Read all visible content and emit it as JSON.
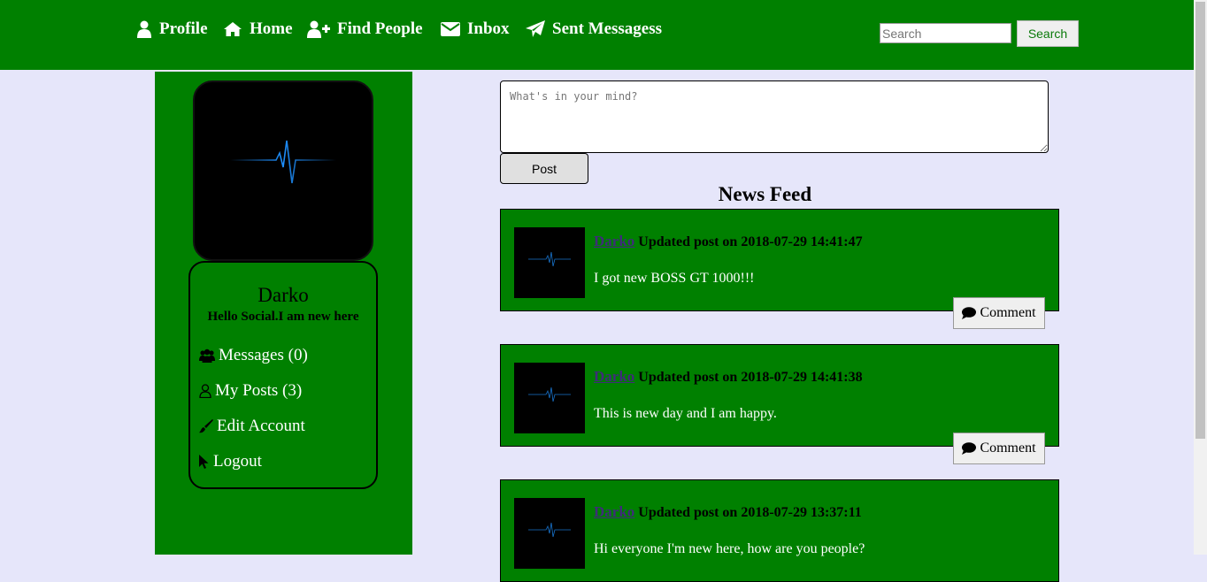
{
  "nav": {
    "profile": "Profile",
    "home": "Home",
    "find_people": "Find People",
    "inbox": "Inbox",
    "sent_messages": "Sent Messagess"
  },
  "search": {
    "placeholder": "Search",
    "button": "Search"
  },
  "sidebar": {
    "name": "Darko",
    "bio": "Hello Social.I am new here",
    "links": {
      "messages": "Messages (0)",
      "my_posts": "My Posts (3)",
      "edit_account": "Edit Account",
      "logout": "Logout"
    }
  },
  "composer": {
    "placeholder": "What's in your mind?",
    "post_button": "Post"
  },
  "feed": {
    "title": "News Feed",
    "comment_label": "Comment",
    "posts": [
      {
        "author": "Darko",
        "meta": "Updated post on 2018-07-29 14:41:47",
        "text": "I got new BOSS GT 1000!!!"
      },
      {
        "author": "Darko",
        "meta": "Updated post on 2018-07-29 14:41:38",
        "text": "This is new day and I am happy."
      },
      {
        "author": "Darko",
        "meta": "Updated post on 2018-07-29 13:37:11",
        "text": "Hi everyone I'm new here, how are you people?"
      }
    ]
  },
  "colors": {
    "header_green": "#008000",
    "page_bg": "#e6e6fa",
    "pulse_blue": "#1e90ff"
  }
}
